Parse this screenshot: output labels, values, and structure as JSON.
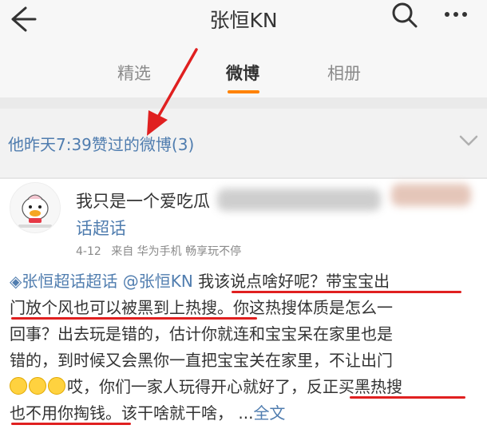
{
  "header": {
    "title": "张恒KN"
  },
  "tabs": [
    {
      "label": "精选"
    },
    {
      "label": "微博"
    },
    {
      "label": "相册"
    }
  ],
  "liked_bar": {
    "text": "他昨天7:39赞过的微博(3)"
  },
  "post": {
    "author_visible": "我只是一个爱吃瓜",
    "topic": "话超话",
    "time": "4-12",
    "from": "来自 华为手机 畅享玩不停",
    "lines": {
      "l1_link": "◈张恒超话超话 @张恒KN",
      "l1_text": " 我该说点啥好呢？带宝宝出",
      "l2": "门放个风也可以被黑到上热搜。你这热搜体质是怎么一",
      "l3": "回事？出去玩是错的，估计你就连和宝宝呆在家里也是",
      "l4": "错的，到时候又会黑你一直把宝宝关在家里，不让出门",
      "l5": "哎，你们一家人玩得开心就好了，反正买黑热搜",
      "l6_text": "也不用你掏钱。该干啥就干啥， ...",
      "l6_link": "全文"
    }
  },
  "colors": {
    "accent": "#ff8200",
    "link": "#507daf",
    "annotation": "#e02020"
  },
  "icons": [
    "back-arrow-icon",
    "search-icon",
    "more-icon",
    "chevron-down-icon",
    "emoji-laugh-cry-icon"
  ]
}
